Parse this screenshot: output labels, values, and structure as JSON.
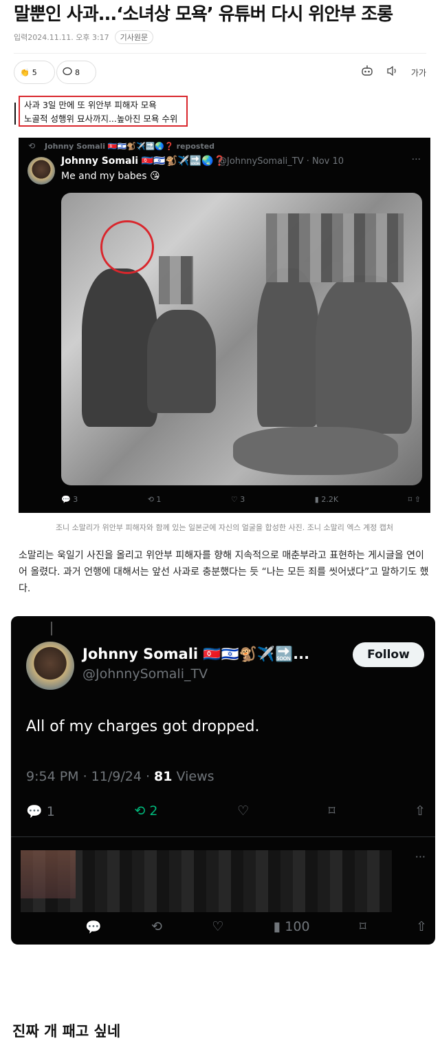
{
  "headline": "말뿐인 사과...‘소녀상 모욕’ 유튜버 다시 위안부 조롱",
  "meta": {
    "date": "입력2024.11.11. 오후 3:17",
    "source_label": "기사원문"
  },
  "toolbar": {
    "reaction_count": "5",
    "comment_count": "8",
    "font_label": "가가"
  },
  "subtitle": {
    "line1": "사과 3일 만에 또 위안부 피해자 모욕",
    "line2": "노골적 성행위 묘사까지...높아진 모욕 수위"
  },
  "tweet1": {
    "reposted": "Johnny Somali 🇰🇵🇮🇱🐒✈️🔜🌏❓ reposted",
    "name": "Johnny Somali 🇰🇵🇮🇱🐒✈️🔜🌏❓",
    "handle": "@JohnnySomali_TV · Nov 10",
    "text": "Me and my babes 😘",
    "replies": "3",
    "reposts": "1",
    "likes": "3",
    "views": "2.2K"
  },
  "caption": "조니 소말리가 위안부 피해자와 함께 있는 일본군에 자신의 얼굴을 합성한 사진. 조니 소말리 엑스 계정 캡처",
  "body": "소말리는 욱일기 사진을 올리고 위안부 피해자를 향해 지속적으로 매춘부라고 표현하는 게시글을 연이어 올렸다. 과거 언행에 대해서는 앞선 사과로 충분했다는 듯 “나는 모든 죄를 씻어냈다”고 말하기도 했다.",
  "tweet2": {
    "name": "Johnny Somali 🇰🇵🇮🇱🐒✈️🔜...",
    "handle": "@JohnnySomali_TV",
    "follow_label": "Follow",
    "text": "All of my charges got dropped.",
    "time": "9:54 PM · 11/9/24 · ",
    "views_count": "81",
    "views_label": " Views",
    "replies": "1",
    "reposts": "2",
    "reply_views": "100"
  },
  "footer": "진짜 개 패고 싶네",
  "colors": {
    "highlight_red": "#d9262c",
    "repost_green": "#00ba7c"
  }
}
